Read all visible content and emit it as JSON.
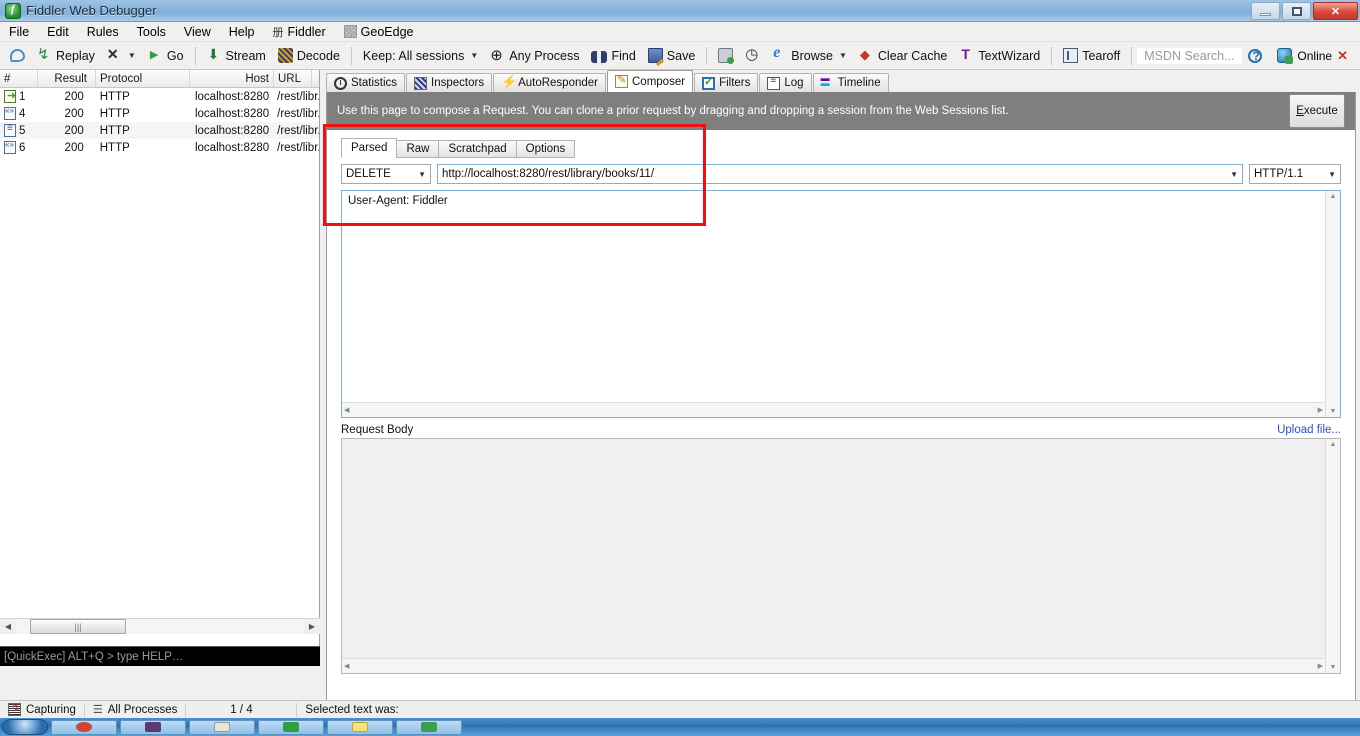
{
  "window": {
    "title": "Fiddler Web Debugger",
    "app_icon": "fiddler-icon",
    "controls": {
      "minimize": "minimize-icon",
      "maximize": "maximize-icon",
      "close": "✕"
    }
  },
  "menu": {
    "items": [
      {
        "label": "File"
      },
      {
        "label": "Edit"
      },
      {
        "label": "Rules"
      },
      {
        "label": "Tools"
      },
      {
        "label": "View"
      },
      {
        "label": "Help"
      },
      {
        "label": "Fiddler",
        "icon": "fiddler-grid-icon",
        "glyph": "册"
      },
      {
        "label": "GeoEdge",
        "icon": "geoedge-icon"
      }
    ]
  },
  "toolbar": {
    "comment_label": "",
    "replay_label": "Replay",
    "remove_label": "",
    "go_label": "Go",
    "stream_label": "Stream",
    "decode_label": "Decode",
    "keep_label": "Keep: All sessions",
    "process_label": "Any Process",
    "find_label": "Find",
    "save_label": "Save",
    "browse_label": "Browse",
    "clear_cache_label": "Clear Cache",
    "textwizard_label": "TextWizard",
    "tearoff_label": "Tearoff",
    "msdn_placeholder": "MSDN Search...",
    "online_label": "Online",
    "close_online_label": "✕"
  },
  "sessions": {
    "columns": [
      "#",
      "Result",
      "Protocol",
      "Host",
      "URL"
    ],
    "rows": [
      {
        "icon": "request-go-icon",
        "num": "1",
        "result": "200",
        "protocol": "HTTP",
        "host": "localhost:8280",
        "url": "/rest/libr..."
      },
      {
        "icon": "xml-doc-icon",
        "num": "4",
        "result": "200",
        "protocol": "HTTP",
        "host": "localhost:8280",
        "url": "/rest/libr..."
      },
      {
        "icon": "text-doc-icon",
        "num": "5",
        "result": "200",
        "protocol": "HTTP",
        "host": "localhost:8280",
        "url": "/rest/libr..."
      },
      {
        "icon": "xml-doc-icon",
        "num": "6",
        "result": "200",
        "protocol": "HTTP",
        "host": "localhost:8280",
        "url": "/rest/libr..."
      }
    ],
    "quickexec_text": "[QuickExec] ALT+Q > type HELP…"
  },
  "main_tabs": [
    {
      "label": "Statistics",
      "icon": "statistics-icon",
      "active": false
    },
    {
      "label": "Inspectors",
      "icon": "inspectors-icon",
      "active": false
    },
    {
      "label": "AutoResponder",
      "icon": "autoresponder-icon",
      "active": false
    },
    {
      "label": "Composer",
      "icon": "composer-icon",
      "active": true
    },
    {
      "label": "Filters",
      "icon": "filters-icon",
      "active": false
    },
    {
      "label": "Log",
      "icon": "log-icon",
      "active": false
    },
    {
      "label": "Timeline",
      "icon": "timeline-icon",
      "active": false
    }
  ],
  "composer": {
    "hint": "Use this page to compose a Request. You can clone a prior request by dragging and dropping a session from the Web Sessions list.",
    "execute_label": "Execute",
    "execute_accel": "E",
    "execute_rest": "xecute",
    "sub_tabs": [
      {
        "label": "Parsed",
        "active": true
      },
      {
        "label": "Raw",
        "active": false
      },
      {
        "label": "Scratchpad",
        "active": false
      },
      {
        "label": "Options",
        "active": false
      }
    ],
    "method": "DELETE",
    "url": "http://localhost:8280/rest/library/books/11/",
    "http_version": "HTTP/1.1",
    "headers": "User-Agent: Fiddler",
    "request_body_label": "Request Body",
    "upload_file_label": "Upload file...",
    "request_body": ""
  },
  "statusbar": {
    "capturing": "Capturing",
    "processes": "All Processes",
    "counter": "1 / 4",
    "selected_text": "Selected text was:"
  },
  "colors": {
    "accent_red": "#ee1111",
    "hint_gray": "#7f7f7f",
    "link_blue": "#2a4fce",
    "title_blue": "#8bb6dd"
  }
}
